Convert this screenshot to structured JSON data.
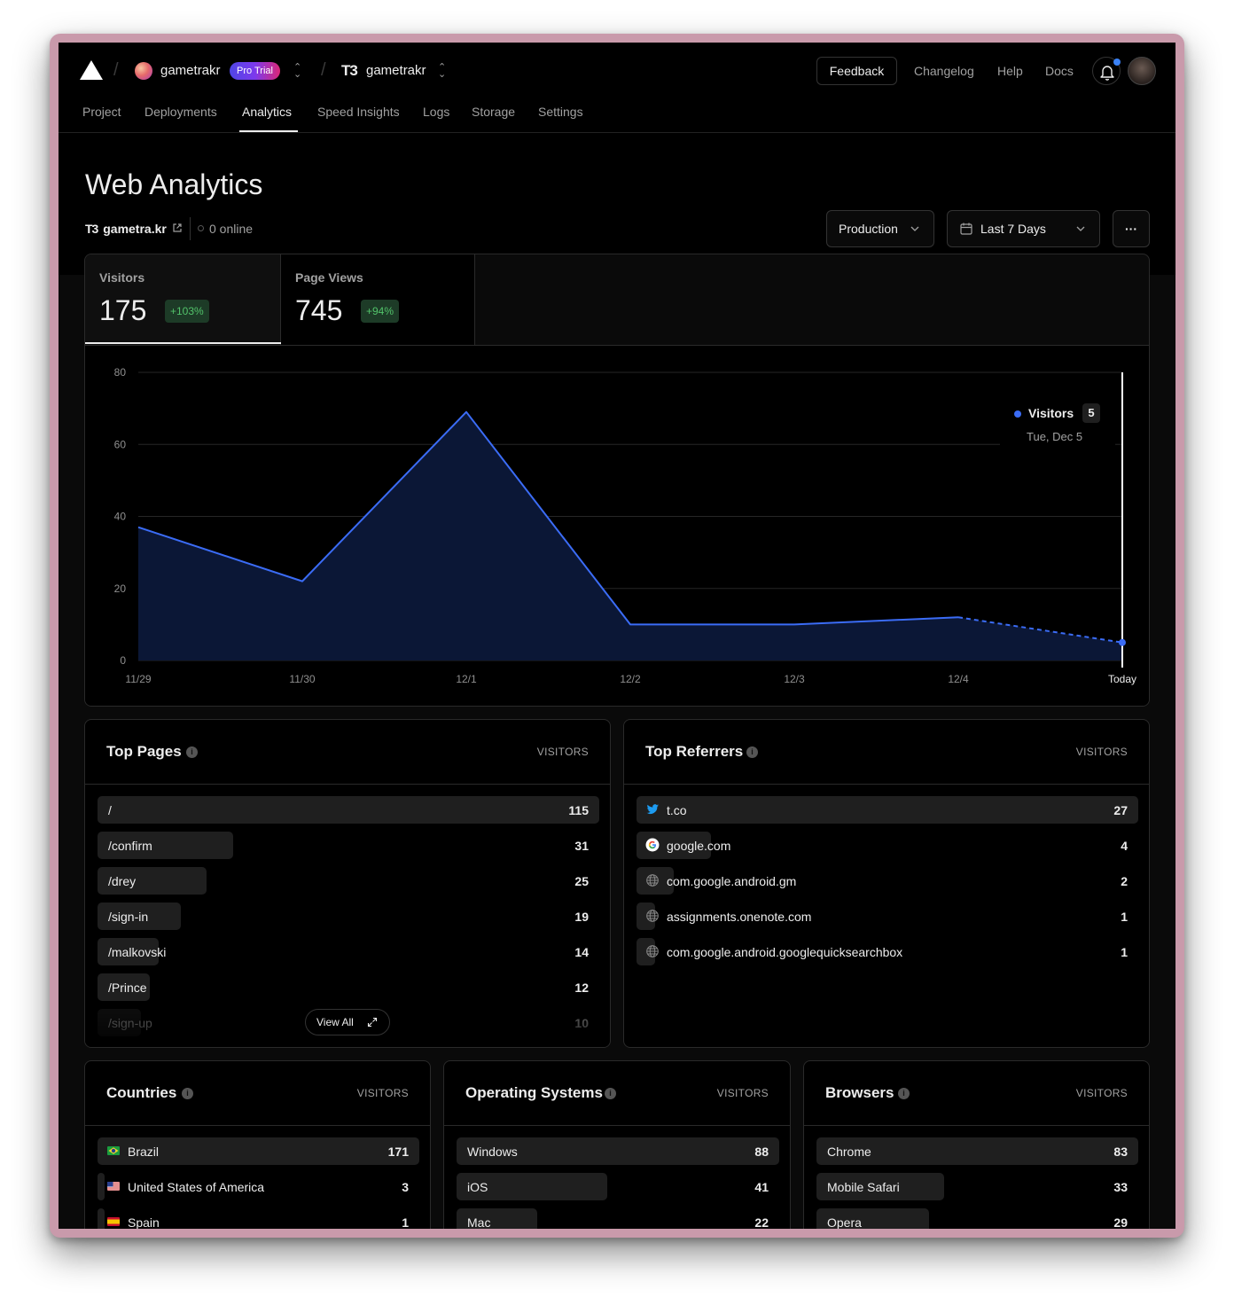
{
  "header": {
    "team_name": "gametrakr",
    "plan_badge": "Pro Trial",
    "project_logo": "T3",
    "project_name": "gametrakr",
    "feedback_label": "Feedback",
    "links": [
      "Changelog",
      "Help",
      "Docs"
    ],
    "icons": {
      "notifications": "bell-icon",
      "user": "avatar"
    }
  },
  "nav": {
    "tabs": [
      "Project",
      "Deployments",
      "Analytics",
      "Speed Insights",
      "Logs",
      "Storage",
      "Settings"
    ],
    "active": "Analytics"
  },
  "page": {
    "title": "Web Analytics",
    "project_logo": "T3",
    "domain": "gametra.kr",
    "online": "0 online",
    "environment": "Production",
    "date_range": "Last 7 Days",
    "more": "···"
  },
  "kpis": [
    {
      "label": "Visitors",
      "value": "175",
      "change": "+103%"
    },
    {
      "label": "Page Views",
      "value": "745",
      "change": "+94%"
    }
  ],
  "tooltip": {
    "series": "Visitors",
    "value": "5",
    "date": "Tue, Dec 5"
  },
  "chart_data": {
    "type": "area",
    "x": [
      "11/29",
      "11/30",
      "12/1",
      "12/2",
      "12/3",
      "12/4",
      "Today"
    ],
    "series": [
      {
        "name": "Visitors",
        "values": [
          37,
          22,
          69,
          10,
          10,
          12,
          5
        ]
      }
    ],
    "ylim": [
      0,
      80
    ],
    "yticks": [
      "0",
      "20",
      "40",
      "60",
      "80"
    ],
    "grid": true,
    "last_segment": "dashed",
    "colors": {
      "line": "#3b6cf6",
      "fill": "#0b1736"
    }
  },
  "top_pages": {
    "title": "Top Pages",
    "column": "VISITORS",
    "view_all": "View All",
    "rows": [
      {
        "label": "/",
        "value": "115",
        "n": 115
      },
      {
        "label": "/confirm",
        "value": "31",
        "n": 31
      },
      {
        "label": "/drey",
        "value": "25",
        "n": 25
      },
      {
        "label": "/sign-in",
        "value": "19",
        "n": 19
      },
      {
        "label": "/malkovski",
        "value": "14",
        "n": 14
      },
      {
        "label": "/Prince",
        "value": "12",
        "n": 12
      },
      {
        "label": "/sign-up",
        "value": "10",
        "n": 10
      }
    ]
  },
  "top_referrers": {
    "title": "Top Referrers",
    "column": "VISITORS",
    "rows": [
      {
        "label": "t.co",
        "value": "27",
        "n": 27,
        "icon": "twitter-icon"
      },
      {
        "label": "google.com",
        "value": "4",
        "n": 4,
        "icon": "google-icon"
      },
      {
        "label": "com.google.android.gm",
        "value": "2",
        "n": 2,
        "icon": "globe-icon"
      },
      {
        "label": "assignments.onenote.com",
        "value": "1",
        "n": 1,
        "icon": "globe-icon"
      },
      {
        "label": "com.google.android.googlequicksearchbox",
        "value": "1",
        "n": 1,
        "icon": "globe-icon"
      }
    ]
  },
  "countries": {
    "title": "Countries",
    "column": "VISITORS",
    "rows": [
      {
        "label": "Brazil",
        "value": "171",
        "n": 171,
        "icon": "brazil-flag-icon"
      },
      {
        "label": "United States of America",
        "value": "3",
        "n": 3,
        "icon": "usa-flag-icon"
      },
      {
        "label": "Spain",
        "value": "1",
        "n": 1,
        "icon": "spain-flag-icon"
      }
    ]
  },
  "operating_systems": {
    "title": "Operating Systems",
    "column": "VISITORS",
    "rows": [
      {
        "label": "Windows",
        "value": "88",
        "n": 88
      },
      {
        "label": "iOS",
        "value": "41",
        "n": 41
      },
      {
        "label": "Mac",
        "value": "22",
        "n": 22
      }
    ]
  },
  "browsers": {
    "title": "Browsers",
    "column": "VISITORS",
    "rows": [
      {
        "label": "Chrome",
        "value": "83",
        "n": 83
      },
      {
        "label": "Mobile Safari",
        "value": "33",
        "n": 33
      },
      {
        "label": "Opera",
        "value": "29",
        "n": 29
      }
    ]
  }
}
